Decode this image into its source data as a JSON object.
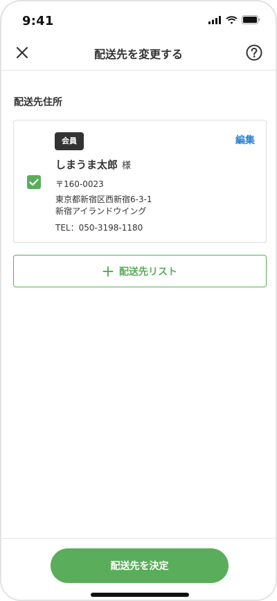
{
  "status_bar": {
    "time": "9:41"
  },
  "header": {
    "title": "配送先を変更する",
    "close_icon": "close-icon",
    "help_icon": "help-icon"
  },
  "section": {
    "title": "配送先住所"
  },
  "address_card": {
    "badge": "会員",
    "edit_label": "編集",
    "name": "しまうま太郎",
    "honorific": "様",
    "postal": "〒160-0023",
    "address_line1": "東京都新宿区西新宿6-3-1",
    "address_line2": "新宿アイランドウイング",
    "tel": "TEL：050-3198-1180",
    "checked": true
  },
  "address_list_button": {
    "label": "配送先リスト",
    "icon": "plus-icon"
  },
  "footer": {
    "submit_label": "配送先を決定"
  },
  "colors": {
    "accent": "#5aad5a",
    "link": "#2a7fd4",
    "badge": "#333333"
  }
}
